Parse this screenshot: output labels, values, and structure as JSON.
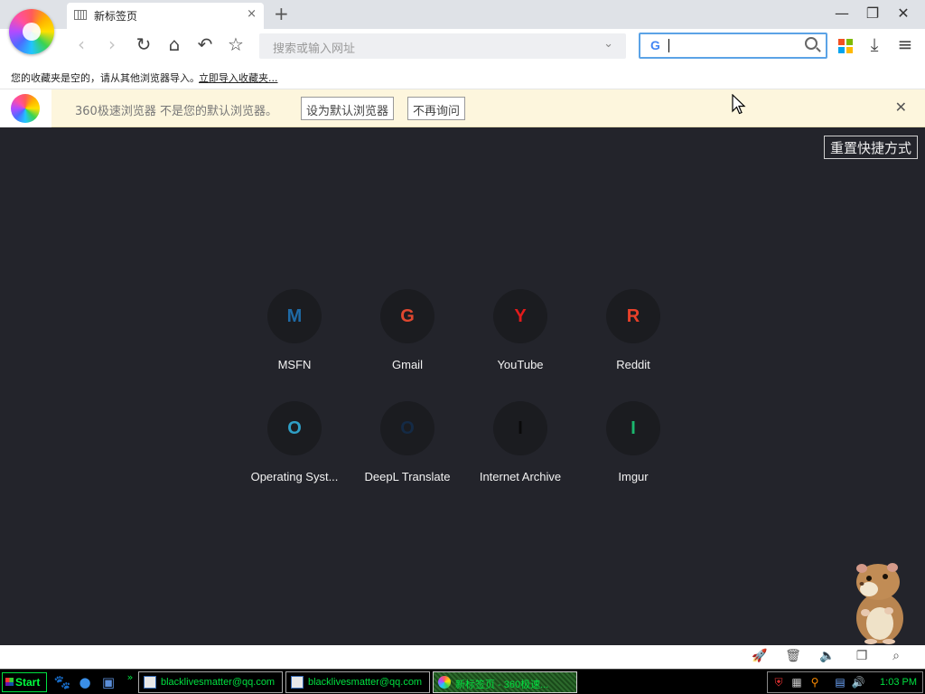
{
  "tab": {
    "title": "新标签页",
    "close": "×",
    "new_tab": "+"
  },
  "window": {
    "minimize": "—",
    "restore": "❐",
    "close": "✕"
  },
  "toolbar": {
    "back": "‹",
    "forward": "›",
    "reload": "↻",
    "home": "⌂",
    "undo": "↶",
    "favorite": "☆",
    "address_placeholder": "搜索或输入网址",
    "address_dropdown": "⌄",
    "search_engine_letter": "G",
    "download": "⤓",
    "menu": "≡"
  },
  "bookmarks": {
    "message": "您的收藏夹是空的，请从其他浏览器导入。",
    "import_link": "立即导入收藏夹..."
  },
  "infobar": {
    "message": "360极速浏览器 不是您的默认浏览器。",
    "set_default": "设为默认浏览器",
    "dont_ask": "不再询问",
    "close": "✕"
  },
  "content": {
    "reset_button": "重置快捷方式",
    "shortcuts": [
      {
        "letter": "M",
        "label": "MSFN",
        "color": "#1f6aa5"
      },
      {
        "letter": "G",
        "label": "Gmail",
        "color": "#e0472f"
      },
      {
        "letter": "Y",
        "label": "YouTube",
        "color": "#e21b1b"
      },
      {
        "letter": "R",
        "label": "Reddit",
        "color": "#e8412a"
      },
      {
        "letter": "O",
        "label": "Operating Syst...",
        "color": "#2f9fc6"
      },
      {
        "letter": "O",
        "label": "DeepL Translate",
        "color": "#142a45"
      },
      {
        "letter": "I",
        "label": "Internet Archive",
        "color": "#0a0a0a"
      },
      {
        "letter": "I",
        "label": "Imgur",
        "color": "#1bb76e"
      }
    ]
  },
  "statusbar": {
    "icons": [
      "rocket-icon",
      "trash-icon",
      "speaker-icon",
      "window-icon",
      "search-icon"
    ]
  },
  "taskbar": {
    "start_label": "Start",
    "quicklaunch_chevron": "»",
    "tasks": [
      {
        "label": "blacklivesmatter@qq.com"
      },
      {
        "label": "blacklivesmatter@qq.com"
      },
      {
        "label": "新标签页 - 360极速..."
      }
    ],
    "clock": "1:03 PM"
  }
}
